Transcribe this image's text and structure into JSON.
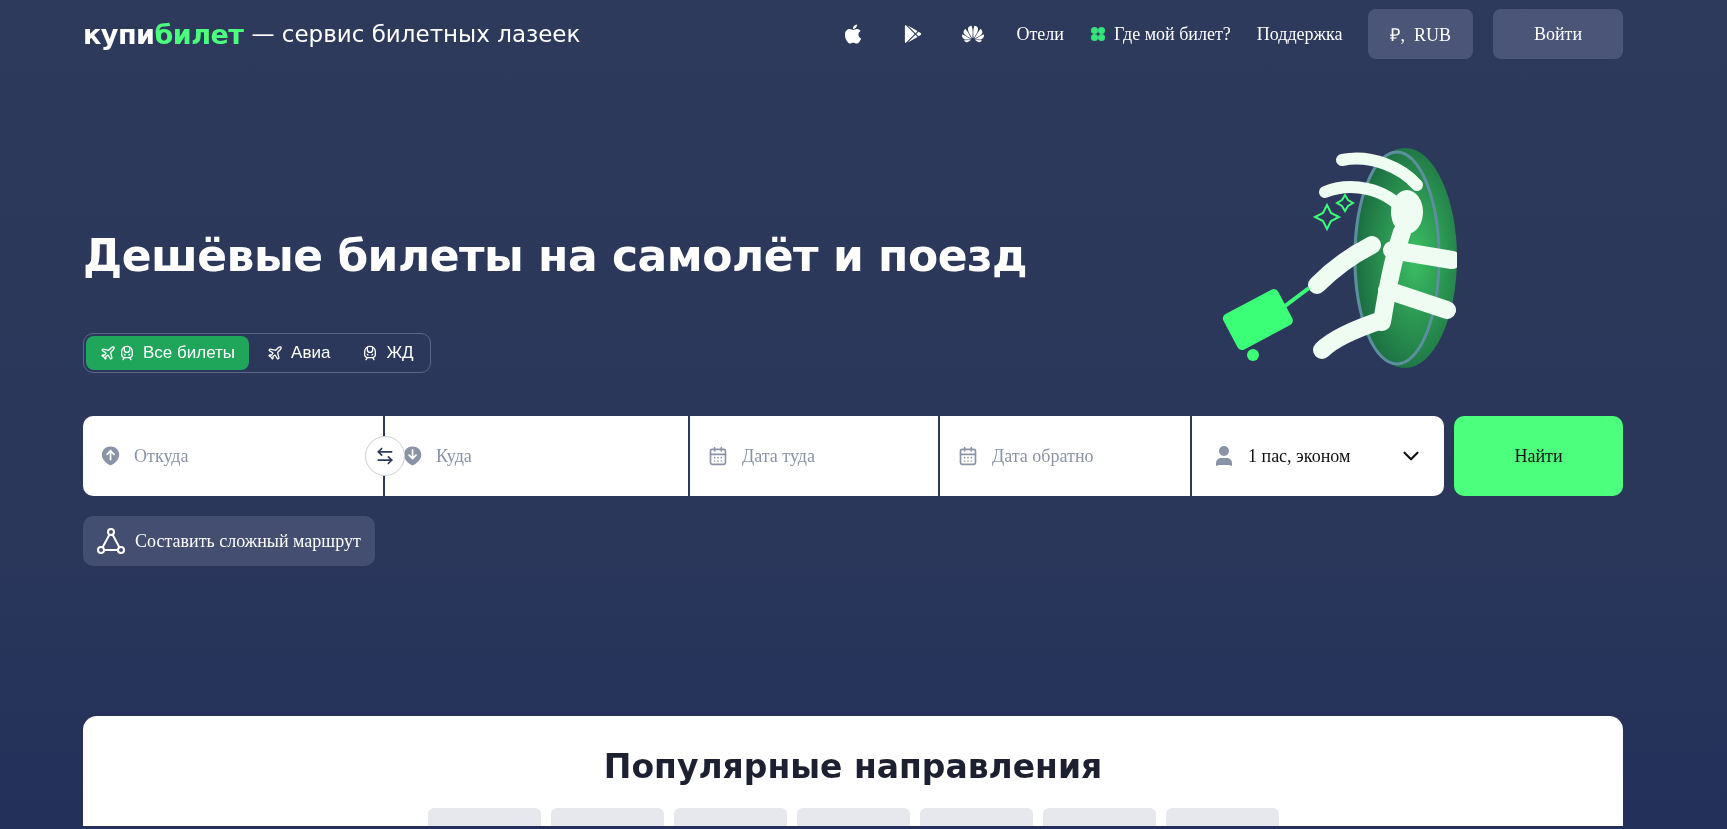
{
  "header": {
    "logo": {
      "first": "купи",
      "second": "билет"
    },
    "tagline": "— сервис билетных лазеек",
    "nav": [
      {
        "kind": "apple"
      },
      {
        "kind": "play"
      },
      {
        "kind": "huawei"
      },
      {
        "kind": "link",
        "label": "Отели"
      },
      {
        "kind": "ticket",
        "label": "Где мой билет?"
      },
      {
        "kind": "link",
        "label": "Поддержка"
      }
    ],
    "currency": {
      "symbol": "₽,",
      "code": "RUB"
    },
    "login": "Войти"
  },
  "hero": {
    "title": "Дешёвые билеты на самолёт и поезд"
  },
  "tabs": [
    {
      "kind": "all",
      "label": "Все билеты",
      "selected": true
    },
    {
      "kind": "avia",
      "label": "Авиа",
      "selected": false
    },
    {
      "kind": "rail",
      "label": "ЖД",
      "selected": false
    }
  ],
  "search": {
    "fields": [
      {
        "kind": "from",
        "placeholder": "Откуда"
      },
      {
        "kind": "to",
        "placeholder": "Куда"
      },
      {
        "kind": "date",
        "placeholder": "Дата туда"
      },
      {
        "kind": "date",
        "placeholder": "Дата обратно"
      }
    ],
    "passengers": "1 пас, эконом",
    "submit": "Найти"
  },
  "complex_route": "Составить сложный маршрут",
  "popular": {
    "title": "Популярные направления"
  }
}
